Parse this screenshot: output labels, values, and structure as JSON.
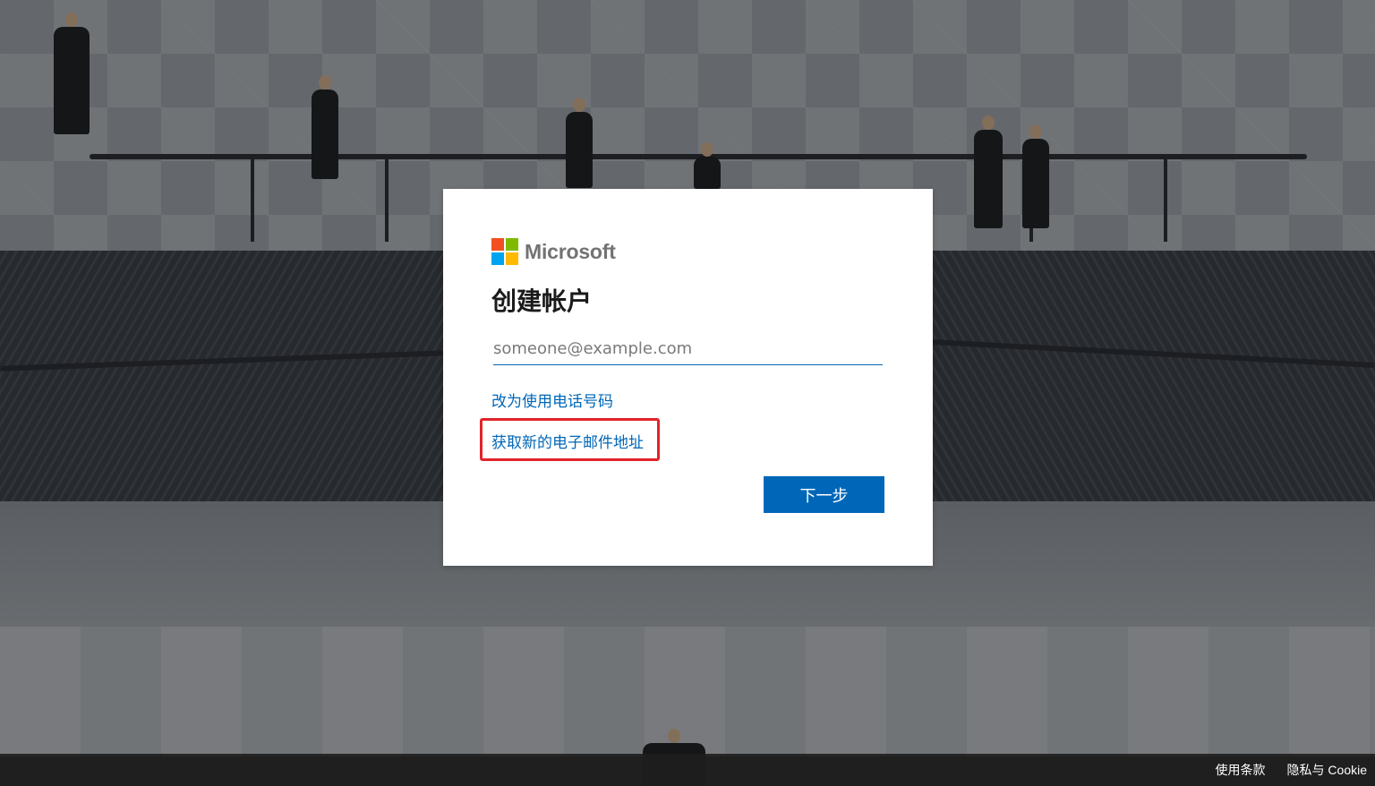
{
  "brand": {
    "name": "Microsoft",
    "colors": {
      "red": "#f25022",
      "green": "#7fba00",
      "blue": "#00a4ef",
      "yellow": "#ffb900"
    }
  },
  "card": {
    "title": "创建帐户",
    "email_placeholder": "someone@example.com",
    "email_value": "",
    "use_phone_link": "改为使用电话号码",
    "get_new_email_link": "获取新的电子邮件地址",
    "next_button": "下一步"
  },
  "footer": {
    "terms": "使用条款",
    "privacy": "隐私与 Cookie"
  },
  "accent_color": "#0067b8",
  "highlight_color": "#e2242a"
}
